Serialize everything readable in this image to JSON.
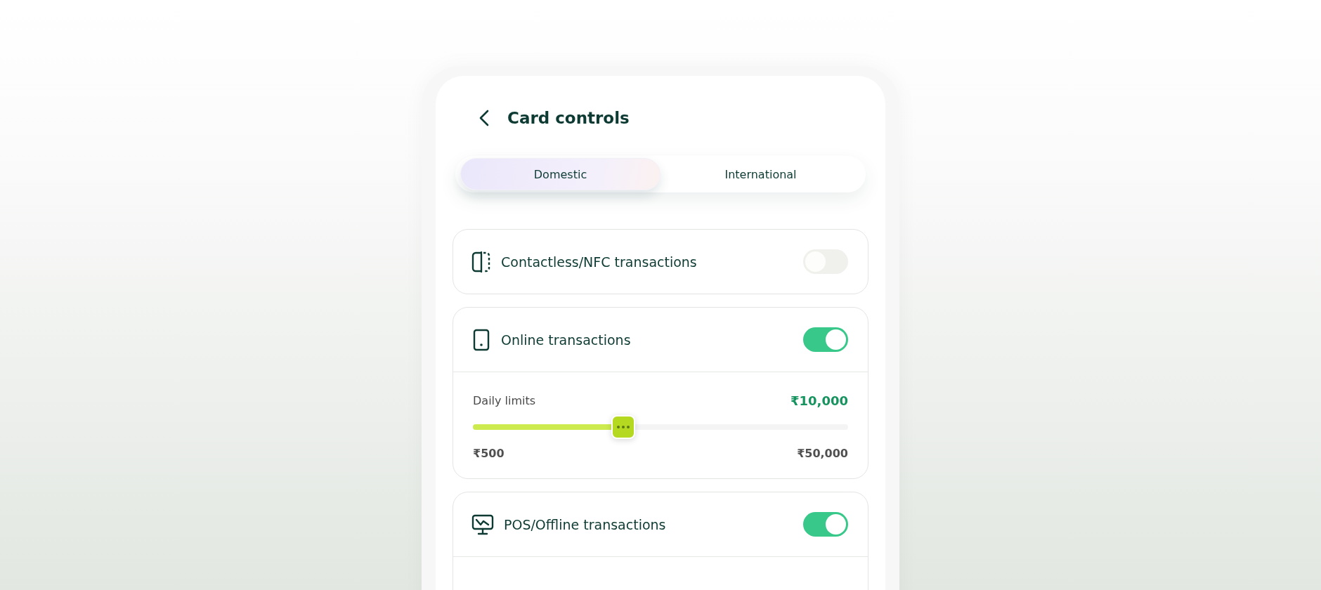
{
  "header": {
    "title": "Card controls"
  },
  "tabs": [
    {
      "label": "Domestic",
      "selected": true
    },
    {
      "label": "International",
      "selected": false
    }
  ],
  "controls": [
    {
      "label": "Contactless/NFC transactions",
      "kind": "nfc",
      "on": false,
      "expanded": false
    },
    {
      "label": "Online transactions",
      "kind": "phone",
      "on": true,
      "expanded": true,
      "limit": {
        "label": "Daily limits",
        "value": "₹10,000",
        "level": 0.4,
        "min": "₹500",
        "max": "₹50,000"
      }
    },
    {
      "label": "POS/Offline transactions",
      "kind": "monitor",
      "on": true,
      "expanded": true
    }
  ]
}
